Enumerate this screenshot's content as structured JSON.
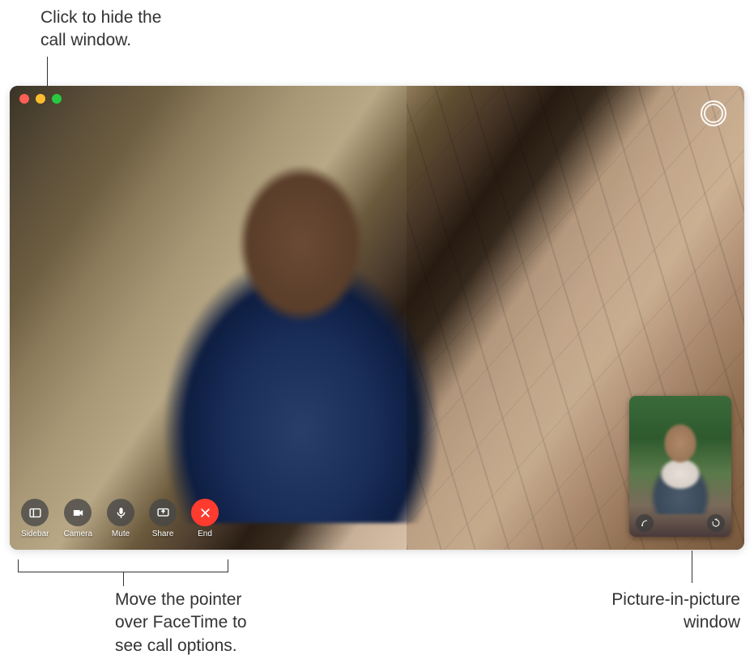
{
  "callouts": {
    "hide_window": "Click to hide the\ncall window.",
    "call_options": "Move the pointer\nover FaceTime to\nsee call options.",
    "pip_label": "Picture-in-picture\nwindow"
  },
  "controls": {
    "sidebar": "Sidebar",
    "camera": "Camera",
    "mute": "Mute",
    "share": "Share",
    "end": "End"
  },
  "icons": {
    "live_photo": "live-photo-icon",
    "pip_effects": "effects-icon",
    "pip_rotate": "rotate-icon"
  }
}
